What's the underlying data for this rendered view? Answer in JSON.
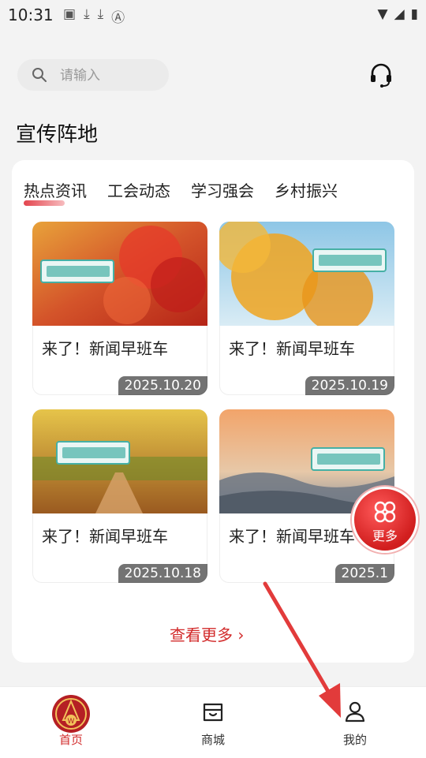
{
  "status_bar": {
    "time": "10:31",
    "left_icons": [
      "image-icon",
      "download-icon",
      "download-icon",
      "a-icon"
    ],
    "right_icons": [
      "wifi-icon",
      "signal-icon",
      "battery-icon"
    ]
  },
  "search": {
    "placeholder": "请输入"
  },
  "section": {
    "title": "宣传阵地"
  },
  "tabs": [
    "热点资讯",
    "工会动态",
    "学习强会",
    "乡村振兴"
  ],
  "news": [
    {
      "date": "2025.10.20",
      "title": "来了！新闻早班车"
    },
    {
      "date": "2025.10.19",
      "title": "来了！新闻早班车"
    },
    {
      "date": "2025.10.18",
      "title": "来了！新闻早班车"
    },
    {
      "date": "2025.1",
      "title": "来了！新闻早班车"
    }
  ],
  "fab": {
    "label": "更多"
  },
  "view_more": {
    "label": "查看更多 ›"
  },
  "bottom_nav": [
    {
      "label": "首页",
      "icon": "union-emblem-icon",
      "active": true
    },
    {
      "label": "商城",
      "icon": "store-icon",
      "active": false
    },
    {
      "label": "我的",
      "icon": "profile-icon",
      "active": false
    }
  ],
  "colors": {
    "accent": "#d22b2b",
    "background": "#f3f3f3",
    "card": "#ffffff"
  }
}
